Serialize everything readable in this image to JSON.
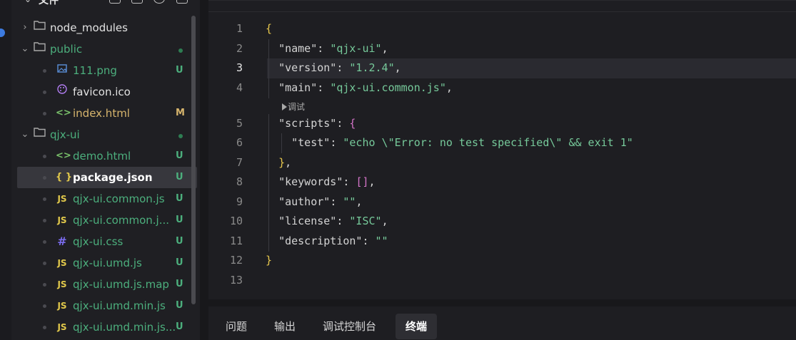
{
  "explorer": {
    "title": "文件",
    "items": [
      {
        "name": "node_modules",
        "type": "folder",
        "expanded": false,
        "status": ""
      },
      {
        "name": "public",
        "type": "folder",
        "expanded": true,
        "status": ""
      },
      {
        "name": "111.png",
        "type": "image",
        "status": "U"
      },
      {
        "name": "favicon.ico",
        "type": "ico",
        "status": ""
      },
      {
        "name": "index.html",
        "type": "html",
        "status": "M"
      },
      {
        "name": "qjx-ui",
        "type": "folder",
        "expanded": true,
        "status": ""
      },
      {
        "name": "demo.html",
        "type": "html",
        "status": "U"
      },
      {
        "name": "package.json",
        "type": "json",
        "status": "U"
      },
      {
        "name": "qjx-ui.common.js",
        "type": "js",
        "status": "U"
      },
      {
        "name": "qjx-ui.common.j...",
        "type": "js",
        "status": "U"
      },
      {
        "name": "qjx-ui.css",
        "type": "css",
        "status": "U"
      },
      {
        "name": "qjx-ui.umd.js",
        "type": "js",
        "status": "U"
      },
      {
        "name": "qjx-ui.umd.js.map",
        "type": "js",
        "status": "U"
      },
      {
        "name": "qjx-ui.umd.min.js",
        "type": "js",
        "status": "U"
      },
      {
        "name": "qjx-ui.umd.min.js...",
        "type": "js",
        "status": "U"
      }
    ]
  },
  "editor": {
    "current_line": 3,
    "codelens_label": "调试",
    "lines": [
      {
        "n": "1",
        "code": "{"
      },
      {
        "n": "2",
        "code": "  \"name\": \"qjx-ui\","
      },
      {
        "n": "3",
        "code": "  \"version\": \"1.2.4\","
      },
      {
        "n": "4",
        "code": "  \"main\": \"qjx-ui.common.js\","
      },
      {
        "n": "5",
        "code": "  \"scripts\": {"
      },
      {
        "n": "6",
        "code": "    \"test\": \"echo \\\"Error: no test specified\\\" && exit 1\""
      },
      {
        "n": "7",
        "code": "  },"
      },
      {
        "n": "8",
        "code": "  \"keywords\": [],"
      },
      {
        "n": "9",
        "code": "  \"author\": \"\","
      },
      {
        "n": "10",
        "code": "  \"license\": \"ISC\","
      },
      {
        "n": "11",
        "code": "  \"description\": \"\""
      },
      {
        "n": "12",
        "code": "}"
      },
      {
        "n": "13",
        "code": ""
      }
    ]
  },
  "panel": {
    "tabs": [
      {
        "label": "问题",
        "active": false
      },
      {
        "label": "输出",
        "active": false
      },
      {
        "label": "调试控制台",
        "active": false
      },
      {
        "label": "终端",
        "active": true
      }
    ]
  },
  "colors": {
    "accent": "#3d7be0",
    "untracked": "#4caf7d",
    "modified": "#d7b56d",
    "string": "#76c99a",
    "brace": "#e8c84d",
    "bracket": "#d474c8"
  }
}
